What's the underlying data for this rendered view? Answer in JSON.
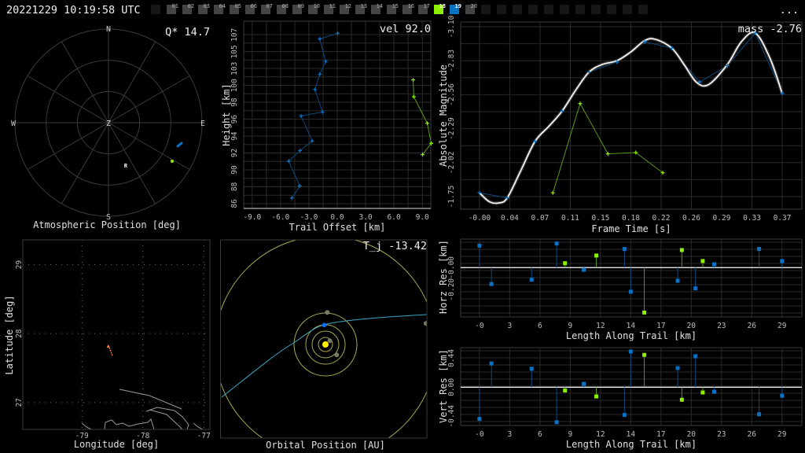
{
  "header": {
    "timestamp": "20221229 10:19:58 UTC",
    "more_label": "...",
    "frames": [
      {
        "label": "",
        "state": "empty"
      },
      {
        "label": "01",
        "state": "normal"
      },
      {
        "label": "02",
        "state": "normal"
      },
      {
        "label": "03",
        "state": "normal"
      },
      {
        "label": "04",
        "state": "normal"
      },
      {
        "label": "05",
        "state": "normal"
      },
      {
        "label": "06",
        "state": "normal"
      },
      {
        "label": "07",
        "state": "normal"
      },
      {
        "label": "08",
        "state": "normal"
      },
      {
        "label": "09",
        "state": "normal"
      },
      {
        "label": "10",
        "state": "normal"
      },
      {
        "label": "11",
        "state": "normal"
      },
      {
        "label": "12",
        "state": "normal"
      },
      {
        "label": "13",
        "state": "normal"
      },
      {
        "label": "14",
        "state": "normal"
      },
      {
        "label": "15",
        "state": "normal"
      },
      {
        "label": "16",
        "state": "normal"
      },
      {
        "label": "17",
        "state": "normal"
      },
      {
        "label": "18",
        "state": "selected-green"
      },
      {
        "label": "19",
        "state": "selected-blue"
      },
      {
        "label": "20",
        "state": "normal"
      },
      {
        "label": "",
        "state": "empty"
      },
      {
        "label": "",
        "state": "empty"
      },
      {
        "label": "",
        "state": "empty"
      },
      {
        "label": "",
        "state": "empty"
      },
      {
        "label": "",
        "state": "empty"
      },
      {
        "label": "",
        "state": "empty"
      },
      {
        "label": "",
        "state": "empty"
      },
      {
        "label": "",
        "state": "empty"
      },
      {
        "label": "",
        "state": "empty"
      },
      {
        "label": "",
        "state": "empty"
      },
      {
        "label": "",
        "state": "empty"
      }
    ]
  },
  "colors": {
    "background": "#000000",
    "station_a": "#0a72c4",
    "station_a_line": "#0b4a80",
    "station_b": "#8cf000",
    "station_b_line": "#5a9a10",
    "fit": "#ffffff",
    "grid": "#2a2a2a",
    "frame": "#3a3a3a",
    "track": "#ff8040",
    "coast": "#9a9a9a",
    "orbit": "#a8a850",
    "sun": "#ffee00",
    "trajectory": "#3aa8c0",
    "frame_normal": "#444444",
    "frame_empty": "#161616"
  },
  "chart_data": [
    {
      "id": "atmospheric",
      "type": "polar-scatter",
      "title": "Atmospheric Position [deg]",
      "annotation": "Q* 14.7",
      "direction_labels": {
        "north": "N",
        "east": "E",
        "south": "S",
        "west": "W",
        "zenith": "Z"
      },
      "rings_zenith_distance_deg": [
        30,
        60,
        90
      ],
      "spoke_step_deg": 30,
      "station_a_track": [
        {
          "az": 108.8,
          "alt": 19.7
        },
        {
          "az": 105.6,
          "alt": 17.0
        }
      ],
      "station_b_track": [
        {
          "az": 121.2,
          "alt": 18.4
        }
      ],
      "radiant": {
        "label": "R",
        "az": 157.8,
        "alt": 46.0
      }
    },
    {
      "id": "height",
      "type": "line",
      "xlabel": "Trail Offset [km]",
      "ylabel": "Height [km]",
      "annotation": "vel 92.0",
      "xlim": [
        -9.9,
        9.9
      ],
      "ylim": [
        85.4,
        108.7
      ],
      "xticks": [
        {
          "v": -9,
          "label": "-9.0"
        },
        {
          "v": -6,
          "label": "-6.0"
        },
        {
          "v": -3,
          "label": "-3.0"
        },
        {
          "v": 0,
          "label": "0.0"
        },
        {
          "v": 3,
          "label": "3.0"
        },
        {
          "v": 6,
          "label": "6.0"
        },
        {
          "v": 9,
          "label": "9.0"
        }
      ],
      "yticks": [
        {
          "v": 86,
          "label": "86"
        },
        {
          "v": 88.1,
          "label": "88"
        },
        {
          "v": 90.2,
          "label": "90"
        },
        {
          "v": 92.3,
          "label": "92"
        },
        {
          "v": 94.4,
          "label": "94"
        },
        {
          "v": 96.5,
          "label": "96"
        },
        {
          "v": 98.6,
          "label": "98"
        },
        {
          "v": 100.7,
          "label": "100"
        },
        {
          "v": 102.8,
          "label": "103"
        },
        {
          "v": 104.9,
          "label": "105"
        },
        {
          "v": 107,
          "label": "107"
        }
      ],
      "grid": true,
      "series": [
        {
          "station": "a",
          "points": [
            [
              0.05,
              107.2
            ],
            [
              -1.86,
              106.5
            ],
            [
              -1.22,
              103.7
            ],
            [
              -1.86,
              102.1
            ],
            [
              -2.36,
              100.2
            ],
            [
              -1.56,
              97.4
            ],
            [
              -3.83,
              96.9
            ],
            [
              -2.64,
              93.8
            ],
            [
              -3.94,
              92.6
            ],
            [
              -5.14,
              91.3
            ],
            [
              -3.97,
              88.2
            ],
            [
              -4.8,
              86.7
            ]
          ]
        },
        {
          "station": "b",
          "points": [
            [
              8.03,
              101.4
            ],
            [
              8.1,
              99.3
            ],
            [
              9.53,
              96.0
            ],
            [
              9.94,
              93.5
            ],
            [
              9.03,
              92.1
            ]
          ]
        }
      ]
    },
    {
      "id": "magnitude",
      "type": "line",
      "xlabel": "Frame Time [s]",
      "ylabel": "Absolute Magnitude",
      "annotation": "mass -2.76",
      "xlim": [
        -0.023,
        0.394
      ],
      "ylim": [
        -1.65,
        -3.1375
      ],
      "xticks": [
        {
          "v": 0,
          "label": "-0.00"
        },
        {
          "v": 0.037,
          "label": "0.04"
        },
        {
          "v": 0.074,
          "label": "0.07"
        },
        {
          "v": 0.111,
          "label": "0.11"
        },
        {
          "v": 0.148,
          "label": "0.15"
        },
        {
          "v": 0.185,
          "label": "0.18"
        },
        {
          "v": 0.222,
          "label": "0.22"
        },
        {
          "v": 0.259,
          "label": "0.26"
        },
        {
          "v": 0.296,
          "label": "0.29"
        },
        {
          "v": 0.333,
          "label": "0.33"
        },
        {
          "v": 0.37,
          "label": "0.37"
        }
      ],
      "yticks": [
        {
          "v": -3.1,
          "label": "-3.10"
        },
        {
          "v": -2.83,
          "label": "-2.83"
        },
        {
          "v": -2.56,
          "label": "-2.56"
        },
        {
          "v": -2.29,
          "label": "-2.29"
        },
        {
          "v": -2.02,
          "label": "-2.02"
        },
        {
          "v": -1.75,
          "label": "-1.75"
        }
      ],
      "grid": true,
      "series": [
        {
          "station": "a",
          "points": [
            [
              0,
              -1.78
            ],
            [
              0.034,
              -1.74
            ],
            [
              0.068,
              -2.19
            ],
            [
              0.101,
              -2.43
            ],
            [
              0.134,
              -2.74
            ],
            [
              0.168,
              -2.82
            ],
            [
              0.202,
              -2.98
            ],
            [
              0.235,
              -2.93
            ],
            [
              0.269,
              -2.66
            ],
            [
              0.303,
              -2.79
            ],
            [
              0.337,
              -3.05
            ],
            [
              0.37,
              -2.57
            ]
          ]
        },
        {
          "station": "b",
          "points": [
            [
              0.0897,
              -1.78
            ],
            [
              0.123,
              -2.49
            ],
            [
              0.157,
              -2.09
            ],
            [
              0.191,
              -2.1
            ],
            [
              0.224,
              -1.94
            ]
          ]
        },
        {
          "station": "fit",
          "points": [
            [
              0,
              -1.78
            ],
            [
              0.012,
              -1.71
            ],
            [
              0.024,
              -1.7
            ],
            [
              0.034,
              -1.74
            ],
            [
              0.05,
              -1.95
            ],
            [
              0.068,
              -2.19
            ],
            [
              0.085,
              -2.31
            ],
            [
              0.101,
              -2.43
            ],
            [
              0.118,
              -2.6
            ],
            [
              0.134,
              -2.74
            ],
            [
              0.15,
              -2.8
            ],
            [
              0.168,
              -2.83
            ],
            [
              0.185,
              -2.9
            ],
            [
              0.202,
              -2.99
            ],
            [
              0.215,
              -3.0
            ],
            [
              0.235,
              -2.93
            ],
            [
              0.25,
              -2.8
            ],
            [
              0.265,
              -2.66
            ],
            [
              0.28,
              -2.64
            ],
            [
              0.303,
              -2.8
            ],
            [
              0.32,
              -2.98
            ],
            [
              0.337,
              -3.05
            ],
            [
              0.355,
              -2.85
            ],
            [
              0.37,
              -2.57
            ]
          ]
        }
      ]
    },
    {
      "id": "horizontal-residuals",
      "type": "stem",
      "xlabel": "Length Along Trail [km]",
      "ylabel": "Horz Res [km]",
      "xlim": [
        -1.8,
        30.9
      ],
      "ylim": [
        -0.45,
        0.26
      ],
      "xticks": [
        {
          "v": 0,
          "label": "-0"
        },
        {
          "v": 2.9,
          "label": "3"
        },
        {
          "v": 5.8,
          "label": "6"
        },
        {
          "v": 8.7,
          "label": "9"
        },
        {
          "v": 11.6,
          "label": "12"
        },
        {
          "v": 14.5,
          "label": "14"
        },
        {
          "v": 17.4,
          "label": "17"
        },
        {
          "v": 20.3,
          "label": "20"
        },
        {
          "v": 23.2,
          "label": "23"
        },
        {
          "v": 26.1,
          "label": "26"
        },
        {
          "v": 29,
          "label": "29"
        }
      ],
      "yticks": [
        {
          "v": 0,
          "label": "-0.00"
        },
        {
          "v": -0.2,
          "label": "-0.20"
        }
      ],
      "grid": true,
      "series": [
        {
          "station": "a",
          "points": [
            [
              0,
              0.2
            ],
            [
              1.15,
              -0.15
            ],
            [
              5.0,
              -0.11
            ],
            [
              7.4,
              0.22
            ],
            [
              10.0,
              -0.02
            ],
            [
              13.9,
              0.17
            ],
            [
              14.5,
              -0.22
            ],
            [
              19.0,
              -0.12
            ],
            [
              20.7,
              -0.19
            ],
            [
              22.5,
              0.03
            ],
            [
              26.8,
              0.17
            ],
            [
              29.0,
              0.06
            ]
          ]
        },
        {
          "station": "b",
          "points": [
            [
              8.2,
              0.04
            ],
            [
              11.2,
              0.11
            ],
            [
              15.8,
              -0.41
            ],
            [
              19.4,
              0.16
            ],
            [
              21.4,
              0.06
            ]
          ]
        }
      ]
    },
    {
      "id": "vertical-residuals",
      "type": "stem",
      "xlabel": "Length Along Trail [km]",
      "ylabel": "Vert Res [km]",
      "xlim": [
        -1.8,
        30.9
      ],
      "ylim": [
        -0.58,
        0.6
      ],
      "xticks": [
        {
          "v": 0,
          "label": "-0"
        },
        {
          "v": 2.9,
          "label": "3"
        },
        {
          "v": 5.8,
          "label": "6"
        },
        {
          "v": 8.7,
          "label": "9"
        },
        {
          "v": 11.6,
          "label": "12"
        },
        {
          "v": 14.5,
          "label": "14"
        },
        {
          "v": 17.4,
          "label": "17"
        },
        {
          "v": 20.3,
          "label": "20"
        },
        {
          "v": 23.2,
          "label": "23"
        },
        {
          "v": 26.1,
          "label": "26"
        },
        {
          "v": 29,
          "label": "29"
        }
      ],
      "yticks": [
        {
          "v": 0.44,
          "label": "0.44"
        },
        {
          "v": 0,
          "label": "0.00"
        },
        {
          "v": -0.44,
          "label": "-0.44"
        }
      ],
      "grid": true,
      "series": [
        {
          "station": "a",
          "points": [
            [
              0,
              -0.48
            ],
            [
              1.15,
              0.36
            ],
            [
              5.0,
              0.28
            ],
            [
              7.4,
              -0.53
            ],
            [
              10.0,
              0.05
            ],
            [
              13.9,
              -0.42
            ],
            [
              14.5,
              0.54
            ],
            [
              19.0,
              0.29
            ],
            [
              20.7,
              0.47
            ],
            [
              22.5,
              -0.07
            ],
            [
              26.8,
              -0.41
            ],
            [
              29.0,
              -0.13
            ]
          ]
        },
        {
          "station": "b",
          "points": [
            [
              8.2,
              -0.05
            ],
            [
              11.2,
              -0.14
            ],
            [
              15.8,
              0.49
            ],
            [
              19.4,
              -0.19
            ],
            [
              21.4,
              -0.08
            ]
          ]
        }
      ]
    },
    {
      "id": "ground-map",
      "type": "map",
      "xlabel": "Longitude [deg]",
      "ylabel": "Latitude [deg]",
      "xlim": [
        -79.97,
        -76.9
      ],
      "ylim": [
        26.61,
        29.36
      ],
      "xticks": [
        {
          "v": -79,
          "label": "-79"
        },
        {
          "v": -78,
          "label": "-78"
        },
        {
          "v": -77,
          "label": "-77"
        }
      ],
      "yticks": [
        {
          "v": 29,
          "label": "29"
        },
        {
          "v": 28,
          "label": "28"
        },
        {
          "v": 27,
          "label": "27"
        }
      ],
      "grid": "dotted",
      "ground_track": [
        [
          -78.5,
          27.68
        ],
        [
          -78.57,
          27.84
        ]
      ]
    },
    {
      "id": "orbit",
      "type": "diagram",
      "title": "Orbital Position [AU]",
      "annotation": "T_j -13.42"
    }
  ]
}
